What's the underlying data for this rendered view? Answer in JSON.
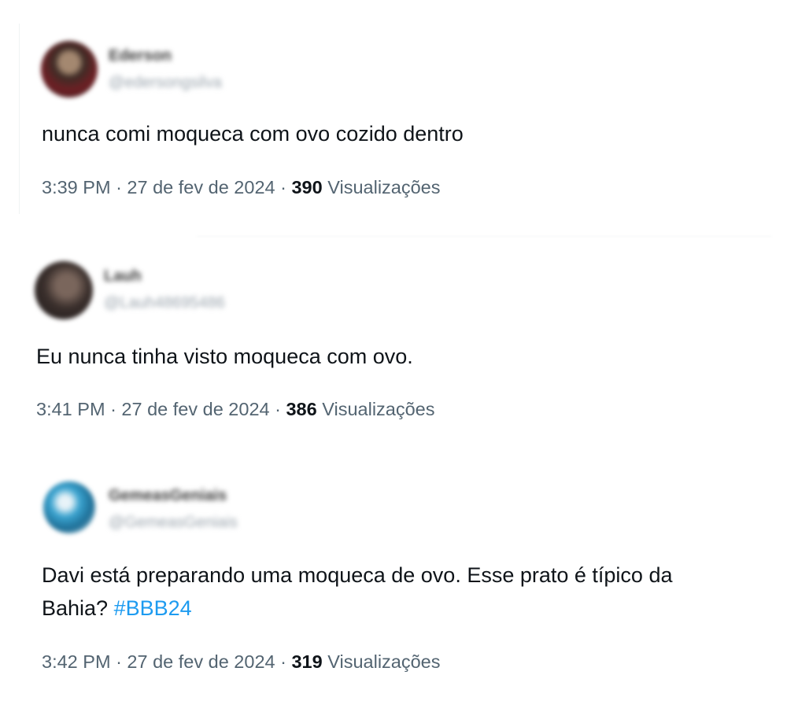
{
  "tweets": [
    {
      "author_name": "Ederson",
      "author_handle": "@edersongsilva",
      "text": "nunca comi moqueca com ovo cozido dentro",
      "time": "3:39 PM",
      "date": "27 de fev de 2024",
      "views": "390",
      "views_label": "Visualizações"
    },
    {
      "author_name": "Lauh",
      "author_handle": "@Lauh48695486",
      "text": "Eu nunca tinha visto moqueca com ovo.",
      "time": "3:41 PM",
      "date": "27 de fev de 2024",
      "views": "386",
      "views_label": "Visualizações"
    },
    {
      "author_name": "GemeasGeniais",
      "author_handle": "@GemeasGeniais",
      "text_line1": "Davi está preparando uma moqueca de ovo. Esse prato é típico da",
      "text_line2": "Bahia?",
      "hashtag": "#BBB24",
      "time": "3:42 PM",
      "date": "27 de fev de 2024",
      "views": "319",
      "views_label": "Visualizações"
    }
  ],
  "separator": "·",
  "colors": {
    "text": "#0f1419",
    "secondary": "#536471",
    "link": "#1d9bf0"
  }
}
